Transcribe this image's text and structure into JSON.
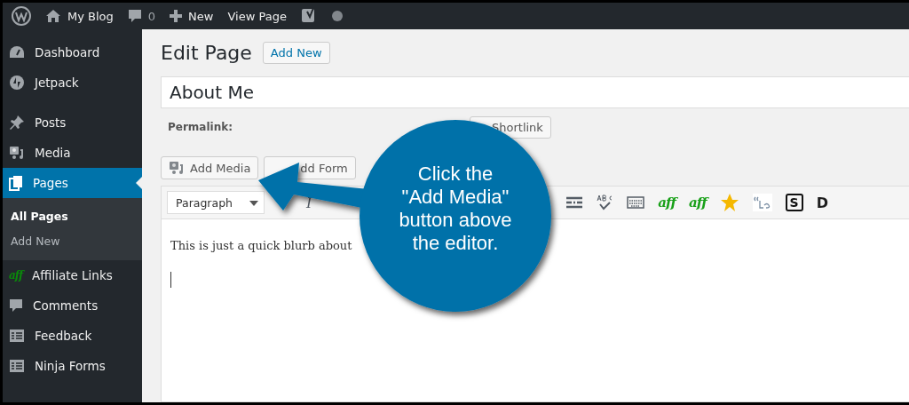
{
  "admin_bar": [
    {
      "kind": "wp"
    },
    {
      "kind": "home",
      "label": "My Blog"
    },
    {
      "kind": "comments",
      "label": "0"
    },
    {
      "kind": "plus",
      "label": "New"
    },
    {
      "kind": "text",
      "label": "View Page"
    },
    {
      "kind": "yoast"
    },
    {
      "kind": "dot"
    }
  ],
  "sidebar": {
    "items": [
      {
        "kind": "gauge",
        "label": "Dashboard",
        "selected": false
      },
      {
        "kind": "bolt",
        "label": "Jetpack",
        "selected": false
      },
      {
        "kind": "pin",
        "label": "Posts",
        "selected": false
      },
      {
        "kind": "media",
        "label": "Media",
        "selected": false
      },
      {
        "kind": "pages",
        "label": "Pages",
        "selected": true,
        "children": [
          {
            "label": "All Pages",
            "selected": true
          },
          {
            "label": "Add New",
            "selected": false
          }
        ]
      },
      {
        "kind": "aff",
        "label": "Affiliate Links",
        "selected": false,
        "icon_text": "aff"
      },
      {
        "kind": "bubble",
        "label": "Comments",
        "selected": false
      },
      {
        "kind": "form",
        "label": "Feedback",
        "selected": false
      },
      {
        "kind": "form",
        "label": "Ninja Forms",
        "selected": false
      }
    ]
  },
  "page": {
    "heading": "Edit Page",
    "add_new": "Add New",
    "title": "About Me",
    "permalink_label": "Permalink:",
    "shortlink_button": "Shortlink",
    "media_buttons": [
      {
        "kind": "media",
        "label": "Add Media"
      },
      {
        "label": "dd Form"
      }
    ],
    "format_select": "Paragraph",
    "toolbar": [
      {
        "kind": "italic",
        "label": "I"
      },
      {
        "kind": "gap"
      },
      {
        "kind": "hr"
      },
      {
        "kind": "spell"
      },
      {
        "kind": "keyboard"
      },
      {
        "kind": "aff",
        "label": "aff"
      },
      {
        "kind": "aff",
        "label": "aff"
      },
      {
        "kind": "star"
      },
      {
        "kind": "quote"
      },
      {
        "kind": "s",
        "label": "S"
      },
      {
        "kind": "d",
        "label": "D"
      }
    ],
    "body_text": "This is just a quick blurb about"
  },
  "callout": {
    "text": "Click the\n\"Add Media\"\nbutton above\nthe editor."
  }
}
